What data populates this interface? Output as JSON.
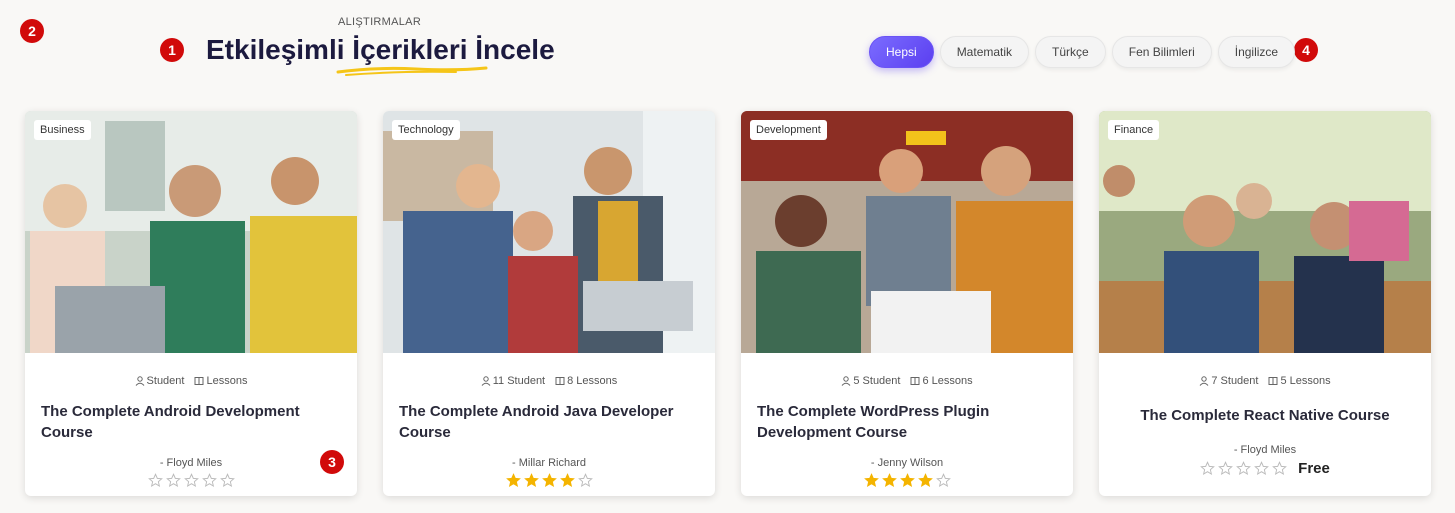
{
  "markers": [
    "1",
    "2",
    "3",
    "4"
  ],
  "header": {
    "eyebrow": "ALIŞTIRMALAR",
    "title": "Etkileşimli İçerikleri İncele"
  },
  "filters": [
    "Hepsi",
    "Matematik",
    "Türkçe",
    "Fen Bilimleri",
    "İngilizce"
  ],
  "active_filter": "Hepsi",
  "cards": [
    {
      "category": "Business",
      "students": "Student",
      "lessons": "Lessons",
      "title": "The Complete Android Development Course",
      "author": "- Floyd Miles",
      "rating": 0,
      "price": ""
    },
    {
      "category": "Technology",
      "students": "11 Student",
      "lessons": "8 Lessons",
      "title": "The Complete Android Java Developer Course",
      "author": "- Millar Richard",
      "rating": 4,
      "price": ""
    },
    {
      "category": "Development",
      "students": "5 Student",
      "lessons": "6 Lessons",
      "title": "The Complete WordPress Plugin Development Course",
      "author": "- Jenny Wilson",
      "rating": 4,
      "price": ""
    },
    {
      "category": "Finance",
      "students": "7 Student",
      "lessons": "5 Lessons",
      "title": "The Complete React Native Course",
      "author": "- Floyd Miles",
      "rating": 0,
      "price": "Free"
    }
  ],
  "colors": {
    "accent": "#6a53f5",
    "star": "#f4b400",
    "star_empty": "#bbbbbb",
    "title": "#1c1a3f",
    "marker": "#d10a0a"
  },
  "icons": {
    "students": "user-icon",
    "lessons": "book-icon",
    "rating": "star-icon"
  }
}
